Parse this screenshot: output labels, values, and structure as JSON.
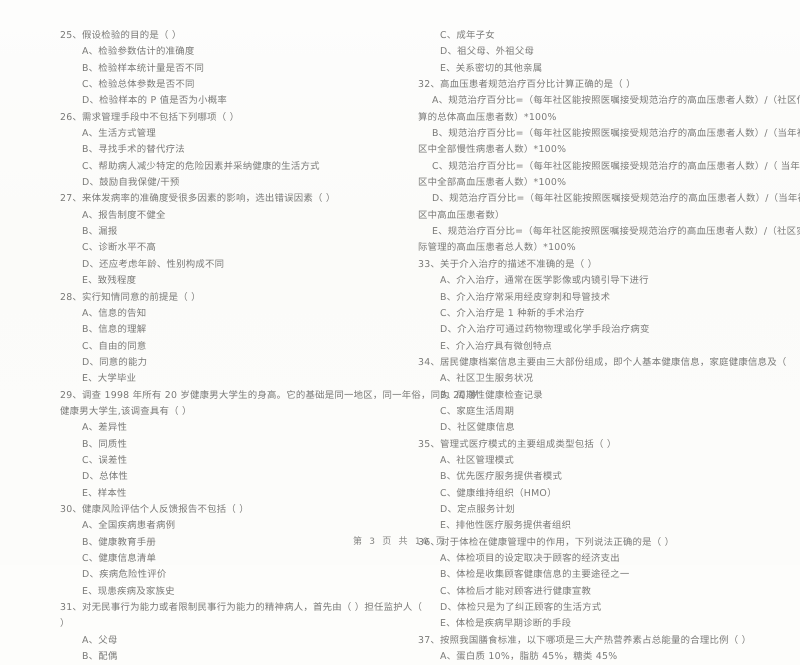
{
  "document": {
    "page_label": "第 3 页 共 10 页",
    "page_number": "3",
    "total_pages": "10",
    "ink_color": "#70706e",
    "paper_color": "#fdfdfb"
  },
  "left_column": [
    {
      "type": "question",
      "text": "25、假设检验的目的是（      ）"
    },
    {
      "type": "option",
      "text": "A、检验参数估计的准确度"
    },
    {
      "type": "option",
      "text": "B、检验样本统计量是否不同"
    },
    {
      "type": "option",
      "text": "C、检验总体参数是否不同"
    },
    {
      "type": "option",
      "text": "D、检验样本的 P 值是否为小概率"
    },
    {
      "type": "question",
      "text": "26、需求管理手段中不包括下列哪项（      ）"
    },
    {
      "type": "option",
      "text": "A、生活方式管理"
    },
    {
      "type": "option",
      "text": "B、寻找手术的替代疗法"
    },
    {
      "type": "option",
      "text": "C、帮助病人减少特定的危险因素并采纳健康的生活方式"
    },
    {
      "type": "option",
      "text": "D、鼓励自我保健/干预"
    },
    {
      "type": "question",
      "text": "27、来体发病率的准确度受很多因素的影响，选出错误因素（      ）"
    },
    {
      "type": "option",
      "text": "A、报告制度不健全"
    },
    {
      "type": "option",
      "text": "B、漏报"
    },
    {
      "type": "option",
      "text": "C、诊断水平不高"
    },
    {
      "type": "option",
      "text": "D、还应考虑年龄、性别构成不同"
    },
    {
      "type": "option",
      "text": "E、致残程度"
    },
    {
      "type": "question",
      "text": "28、实行知情同意的前提是（      ）"
    },
    {
      "type": "option",
      "text": "A、信息的告知"
    },
    {
      "type": "option",
      "text": "B、信息的理解"
    },
    {
      "type": "option",
      "text": "C、自由的同意"
    },
    {
      "type": "option",
      "text": "D、同意的能力"
    },
    {
      "type": "option",
      "text": "E、大学毕业"
    },
    {
      "type": "question",
      "text": "29、调查 1998 年所有 20 岁健康男大学生的身高。它的基础是同一地区，同一年俗，同为 20 岁"
    },
    {
      "type": "continuation",
      "text": "健康男大学生,该调查具有（      ）"
    },
    {
      "type": "option",
      "text": "A、差异性"
    },
    {
      "type": "option",
      "text": "B、同质性"
    },
    {
      "type": "option",
      "text": "C、误差性"
    },
    {
      "type": "option",
      "text": "D、总体性"
    },
    {
      "type": "option",
      "text": "E、样本性"
    },
    {
      "type": "question",
      "text": "30、健康风险评估个人反馈报告不包括（      ）"
    },
    {
      "type": "option",
      "text": "A、全国疾病患者病例"
    },
    {
      "type": "option",
      "text": "B、健康教育手册"
    },
    {
      "type": "option",
      "text": "C、健康信息清单"
    },
    {
      "type": "option",
      "text": "D、疾病危险性评价"
    },
    {
      "type": "option",
      "text": "E、现患疾病及家族史"
    },
    {
      "type": "question",
      "text": "31、对无民事行为能力或者限制民事行为能力的精神病人，首先由（         ）担任监护人（"
    },
    {
      "type": "continuation",
      "text": "）"
    },
    {
      "type": "option",
      "text": "A、父母"
    },
    {
      "type": "option",
      "text": "B、配偶"
    }
  ],
  "right_column": [
    {
      "type": "option",
      "text": "C、成年子女"
    },
    {
      "type": "option",
      "text": "D、祖父母、外祖父母"
    },
    {
      "type": "option",
      "text": "E、关系密切的其他亲属"
    },
    {
      "type": "question",
      "text": "32、高血压患者规范治疗百分比计算正确的是（      ）"
    },
    {
      "type": "formula",
      "text": "A、规范治疗百分比=（每年社区能按照医嘱接受规范治疗的高血压患者人数）/（社区估"
    },
    {
      "type": "formula-cont",
      "text": "算的总体高血压患者数）*100%"
    },
    {
      "type": "formula",
      "text": "B、规范治疗百分比=（每年社区能按照医嘱接受规范治疗的高血压患者人数）/（当年社"
    },
    {
      "type": "formula-cont",
      "text": "区中全部慢性病患者人数）*100%"
    },
    {
      "type": "formula",
      "text": "C、规范治疗百分比=（每年社区能按照医嘱接受规范治疗的高血压患者人数）/（  当年社"
    },
    {
      "type": "formula-cont",
      "text": "区中全部高血压患者人数）*100%"
    },
    {
      "type": "formula",
      "text": "D、规范治疗百分比=（每年社区能按照医嘱接受规范治疗的高血压患者人数）/（当年社"
    },
    {
      "type": "formula-cont",
      "text": "区中高血压患者数）"
    },
    {
      "type": "formula",
      "text": "E、规范治疗百分比=（每年社区能按照医嘱接受规范治疗的高血压患者人数）/（社区实"
    },
    {
      "type": "formula-cont",
      "text": "际管理的高血压患者总人数）*100%"
    },
    {
      "type": "question",
      "text": "33、关于介入治疗的描述不准确的是（      ）"
    },
    {
      "type": "option",
      "text": "A、介入治疗，通常在医学影像或内镜引导下进行"
    },
    {
      "type": "option",
      "text": "B、介入治疗常采用经皮穿刺和导管技术"
    },
    {
      "type": "option",
      "text": "C、介入治疗是 1 种新的手术治疗"
    },
    {
      "type": "option",
      "text": "D、介入治疗可通过药物物理或化学手段治疗病变"
    },
    {
      "type": "option",
      "text": "E、介入治疗具有微创特点"
    },
    {
      "type": "question",
      "text": "34、居民健康档案信息主要由三大部份组成，即个人基本健康信息，家庭健康信息及（      "
    },
    {
      "type": "option",
      "text": "A、社区卫生服务状况"
    },
    {
      "type": "option",
      "text": "B、周期性健康检查记录"
    },
    {
      "type": "option",
      "text": "C、家庭生活周期"
    },
    {
      "type": "option",
      "text": "D、社区健康信息"
    },
    {
      "type": "question",
      "text": "35、管理式医疗模式的主要组成类型包括（      ）"
    },
    {
      "type": "option",
      "text": "A、社区管理模式"
    },
    {
      "type": "option",
      "text": "B、优先医疗服务提供者模式"
    },
    {
      "type": "option",
      "text": "C、健康维持组织（HMO）"
    },
    {
      "type": "option",
      "text": "D、定点服务计划"
    },
    {
      "type": "option",
      "text": "E、排他性医疗服务提供者组织"
    },
    {
      "type": "question",
      "text": "36、对于体检在健康管理中的作用，下列说法正确的是（      ）"
    },
    {
      "type": "option",
      "text": "A、体检项目的设定取决于顾客的经济支出"
    },
    {
      "type": "option",
      "text": "B、体检是收集顾客健康信息的主要途径之一"
    },
    {
      "type": "option",
      "text": "C、体检后才能对顾客进行健康宣教"
    },
    {
      "type": "option",
      "text": "D、体检只是为了纠正顾客的生活方式"
    },
    {
      "type": "option",
      "text": "E、体检是疾病早期诊断的手段"
    },
    {
      "type": "question",
      "text": "37、按照我国膳食标准，以下哪项是三大产热营养素占总能量的合理比例（      ）"
    },
    {
      "type": "option",
      "text": "A、蛋白质 10%，脂肪 45%，糖类 45%"
    }
  ]
}
